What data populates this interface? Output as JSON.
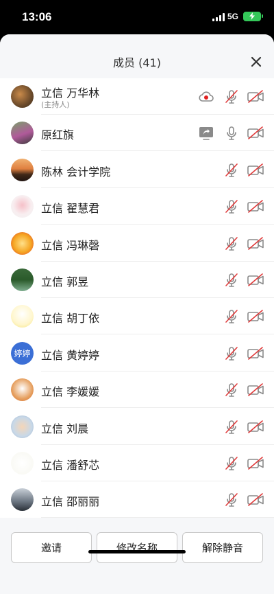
{
  "status": {
    "time": "13:06",
    "network": "5G"
  },
  "header": {
    "title": "成员 (41)"
  },
  "members": [
    {
      "name": "立信 万华林",
      "sub": "(主持人)"
    },
    {
      "name": "原红旗"
    },
    {
      "name": "陈林 会计学院"
    },
    {
      "name": "立信 翟慧君"
    },
    {
      "name": "立信 冯琳磬"
    },
    {
      "name": "立信 郭昱"
    },
    {
      "name": "立信 胡丁依"
    },
    {
      "name": "立信 黄婷婷",
      "avatar_text": "婷婷"
    },
    {
      "name": "立信 李媛媛"
    },
    {
      "name": "立信 刘晨"
    },
    {
      "name": "立信 潘舒芯"
    },
    {
      "name": "立信 邵丽丽"
    }
  ],
  "buttons": {
    "invite": "邀请",
    "rename": "修改名称",
    "unmute": "解除静音"
  },
  "colors": {
    "accent": "#3b6fd6",
    "muted_slash": "#e03b3b",
    "record_dot": "#e02020"
  }
}
